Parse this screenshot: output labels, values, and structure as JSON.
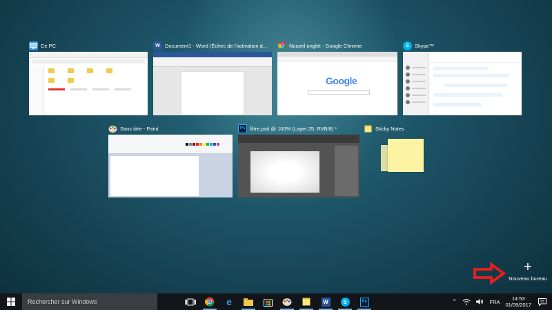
{
  "windows": [
    {
      "title": "Ce PC",
      "app": "file-explorer"
    },
    {
      "title": "Document1 - Word (Échec de l'activation d...",
      "app": "word"
    },
    {
      "title": "Nouvel onglet - Google Chrome",
      "app": "chrome"
    },
    {
      "title": "Skype™",
      "app": "skype"
    },
    {
      "title": "Sans titre - Paint",
      "app": "paint"
    },
    {
      "title": "filtre.psd @ 100% (Layer 25, RVB/8) *",
      "app": "photoshop"
    },
    {
      "title": "Sticky Notes",
      "app": "sticky-notes"
    }
  ],
  "thumbnails": {
    "chrome_logo": "Google",
    "word_icon": "W",
    "skype_icon": "S",
    "photoshop_icon": "Ps"
  },
  "new_desktop": {
    "label": "Nouveau bureau",
    "icon": "+"
  },
  "taskbar": {
    "search_placeholder": "Rechercher sur Windows",
    "apps": [
      "task-view",
      "chrome",
      "edge",
      "file-explorer",
      "store",
      "paint",
      "sticky-notes",
      "word",
      "skype",
      "photoshop"
    ],
    "language": "FRA",
    "time": "14:53",
    "date": "01/09/2017"
  },
  "colors": {
    "taskbar": "#12161a",
    "search_box": "#3a3d42",
    "word": "#2b579a",
    "skype": "#00aff0",
    "photoshop": "#001e36",
    "annotation_arrow": "#e0201f"
  }
}
